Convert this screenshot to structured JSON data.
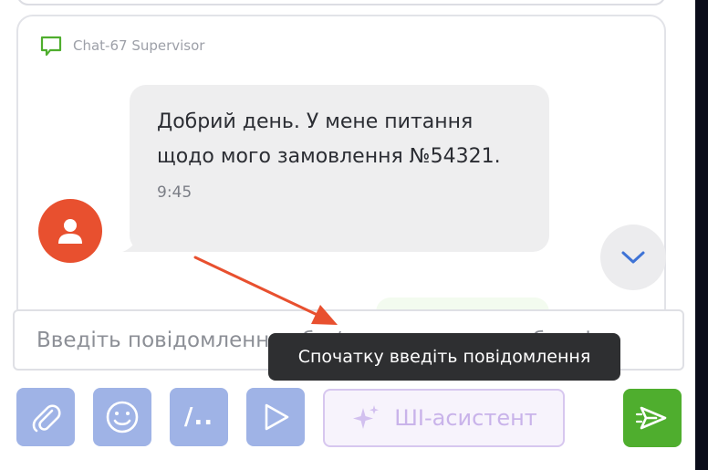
{
  "chat": {
    "header_label": "Chat-67 Supervisor",
    "header_icon": "chat-bubble-icon",
    "message": {
      "text": "Добрий день. У мене питання щодо мого замовлення №54321.",
      "time": "9:45"
    },
    "avatar_icon": "user-icon",
    "scroll_down_icon": "chevron-down-icon"
  },
  "composer": {
    "placeholder": "Введіть повідомлення або / для швидких шаблонів",
    "tooltip": "Спочатку введіть повідомлення",
    "toolbar": {
      "attach_icon": "paperclip-icon",
      "emoji_icon": "smiley-icon",
      "templates_label": "/..",
      "play_icon": "play-icon",
      "ai_label": "ШІ-асистент",
      "ai_icon": "sparkles-icon",
      "send_icon": "send-icon"
    }
  },
  "colors": {
    "avatar": "#e8502f",
    "toolbar_button": "#9fb3e6",
    "send_button": "#4fae2e",
    "tooltip_bg": "#2e2f31",
    "annotation_arrow": "#e8502f",
    "chat_icon": "#4fae2e"
  }
}
